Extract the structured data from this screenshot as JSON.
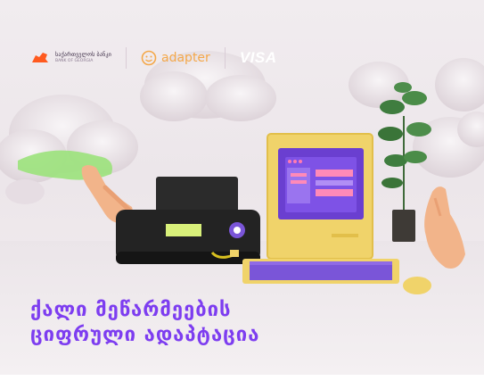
{
  "logos": {
    "bank_name": "საქართველოს ბანკი",
    "bank_sub": "BANK OF GEORGIA",
    "adapter_text": "adapter",
    "visa_text": "VISA"
  },
  "headline": {
    "line1": "ქალი მეწარმეების",
    "line2": "ციფრული ადაპტაცია"
  },
  "colors": {
    "headline": "#7d3df0",
    "adapter": "#f4a84a",
    "monitor_screen": "#6a3fd0",
    "computer_body": "#f0d36a",
    "printer_body": "#222222",
    "slime": "#9be27b"
  }
}
